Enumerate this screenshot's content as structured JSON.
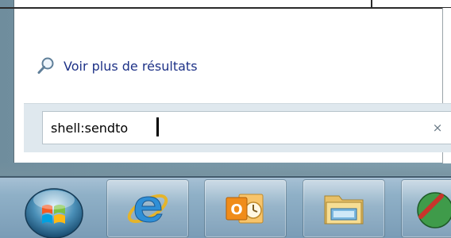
{
  "start_menu": {
    "see_more_results": "Voir plus de résultats",
    "search": {
      "value": "shell:sendto",
      "clear_glyph": "×"
    }
  },
  "icons": {
    "see_more": "magnifier-icon",
    "clear": "clear-search-icon",
    "start": "windows-orb-icon",
    "ie": "internet-explorer-icon",
    "outlook": "outlook-icon",
    "explorer": "file-explorer-icon",
    "partial": "network-globe-icon"
  },
  "colors": {
    "link_text": "#1e3287",
    "search_bg": "#dfe8ee",
    "taskbar": "#8fb0c7"
  }
}
